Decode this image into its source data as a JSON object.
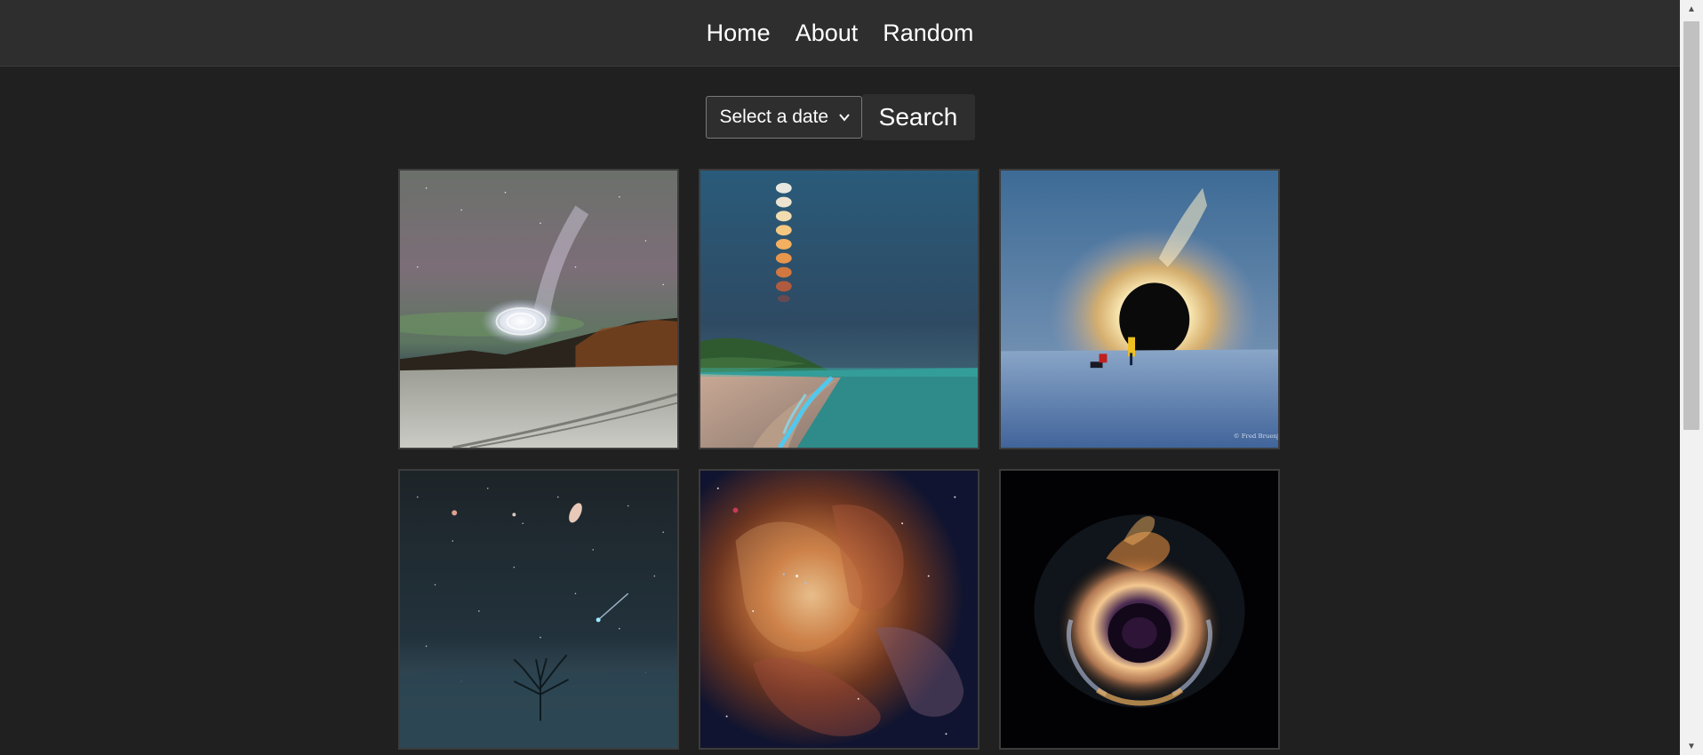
{
  "nav": {
    "items": [
      {
        "label": "Home"
      },
      {
        "label": "About"
      },
      {
        "label": "Random"
      }
    ]
  },
  "search": {
    "date_select": {
      "selected": "Select a date"
    },
    "button_label": "Search"
  },
  "gallery": {
    "cards": [
      {
        "subject": "spiral-over-snowy-field"
      },
      {
        "subject": "moon-sequence-over-glowing-beach"
      },
      {
        "subject": "solar-eclipse-over-ice",
        "credit": "© Fred Bruenjes"
      },
      {
        "subject": "comet-andromeda-over-tree"
      },
      {
        "subject": "colorful-nebula"
      },
      {
        "subject": "supernova-remnant"
      }
    ]
  },
  "colors": {
    "page_bg": "#202020",
    "navbar_bg": "#2e2e2e",
    "text": "#ffffff"
  }
}
